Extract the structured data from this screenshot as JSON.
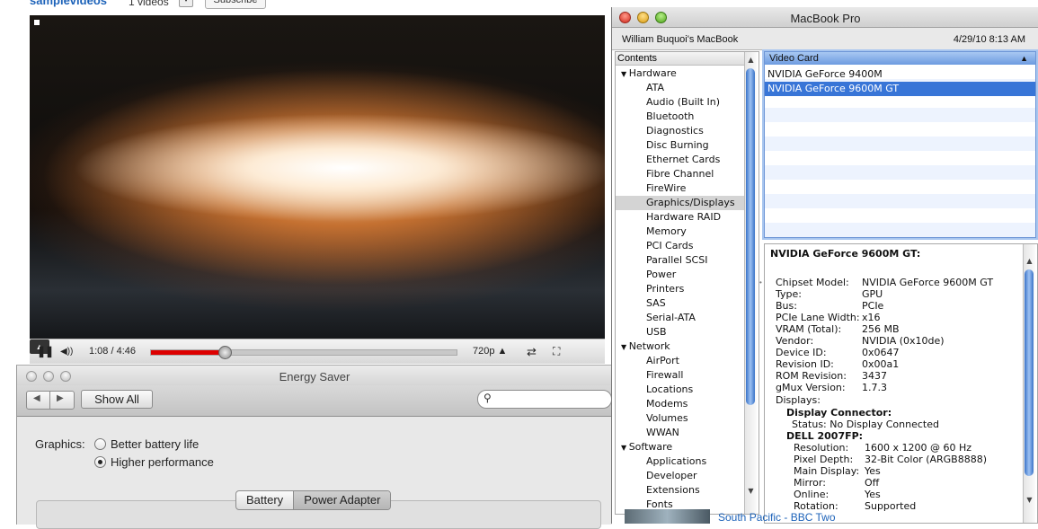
{
  "youtube": {
    "channel": "samplevideos",
    "videos_count": "1 videos",
    "subscribe_label": "Subscribe",
    "time": "1:08 / 4:46",
    "progress": 0.24,
    "quality": "720p",
    "related_link": "South Pacific - BBC Two"
  },
  "energy_saver": {
    "title": "Energy Saver",
    "show_all": "Show All",
    "search_placeholder": "",
    "graphics_label": "Graphics:",
    "options": [
      "Better battery life",
      "Higher performance"
    ],
    "selected_option": "Higher performance",
    "tabs": [
      "Battery",
      "Power Adapter"
    ],
    "selected_tab": "Power Adapter"
  },
  "profiler": {
    "title": "MacBook Pro",
    "machine_name": "William Buquoi's MacBook",
    "date": "4/29/10 8:13 AM",
    "contents_header": "Contents",
    "tree": [
      {
        "label": "Hardware",
        "type": "cat"
      },
      {
        "label": "ATA",
        "type": "item"
      },
      {
        "label": "Audio (Built In)",
        "type": "item"
      },
      {
        "label": "Bluetooth",
        "type": "item"
      },
      {
        "label": "Diagnostics",
        "type": "item"
      },
      {
        "label": "Disc Burning",
        "type": "item"
      },
      {
        "label": "Ethernet Cards",
        "type": "item"
      },
      {
        "label": "Fibre Channel",
        "type": "item"
      },
      {
        "label": "FireWire",
        "type": "item"
      },
      {
        "label": "Graphics/Displays",
        "type": "item",
        "selected": true
      },
      {
        "label": "Hardware RAID",
        "type": "item"
      },
      {
        "label": "Memory",
        "type": "item"
      },
      {
        "label": "PCI Cards",
        "type": "item"
      },
      {
        "label": "Parallel SCSI",
        "type": "item"
      },
      {
        "label": "Power",
        "type": "item"
      },
      {
        "label": "Printers",
        "type": "item"
      },
      {
        "label": "SAS",
        "type": "item"
      },
      {
        "label": "Serial-ATA",
        "type": "item"
      },
      {
        "label": "USB",
        "type": "item"
      },
      {
        "label": "Network",
        "type": "cat"
      },
      {
        "label": "AirPort",
        "type": "item"
      },
      {
        "label": "Firewall",
        "type": "item"
      },
      {
        "label": "Locations",
        "type": "item"
      },
      {
        "label": "Modems",
        "type": "item"
      },
      {
        "label": "Volumes",
        "type": "item"
      },
      {
        "label": "WWAN",
        "type": "item"
      },
      {
        "label": "Software",
        "type": "cat"
      },
      {
        "label": "Applications",
        "type": "item"
      },
      {
        "label": "Developer",
        "type": "item"
      },
      {
        "label": "Extensions",
        "type": "item"
      },
      {
        "label": "Fonts",
        "type": "item"
      }
    ],
    "card_header": "Video Card",
    "cards": [
      "NVIDIA GeForce 9400M",
      "NVIDIA GeForce 9600M GT"
    ],
    "selected_card": "NVIDIA GeForce 9600M GT",
    "detail_title": "NVIDIA GeForce 9600M GT:",
    "details": [
      {
        "k": "Chipset Model:",
        "v": "NVIDIA GeForce 9600M GT"
      },
      {
        "k": "Type:",
        "v": "GPU"
      },
      {
        "k": "Bus:",
        "v": "PCIe"
      },
      {
        "k": "PCIe Lane Width:",
        "v": "x16"
      },
      {
        "k": "VRAM (Total):",
        "v": "256 MB"
      },
      {
        "k": "Vendor:",
        "v": "NVIDIA (0x10de)"
      },
      {
        "k": "Device ID:",
        "v": "0x0647"
      },
      {
        "k": "Revision ID:",
        "v": "0x00a1"
      },
      {
        "k": "ROM Revision:",
        "v": "3437"
      },
      {
        "k": "gMux Version:",
        "v": "1.7.3"
      }
    ],
    "displays_label": "Displays:",
    "display_connector_label": "Display Connector:",
    "display_connector_status": "Status:  No Display Connected",
    "dell_label": "DELL 2007FP:",
    "dell_details": [
      {
        "k": "Resolution:",
        "v": "1600 x 1200 @ 60 Hz"
      },
      {
        "k": "Pixel Depth:",
        "v": "32-Bit Color (ARGB8888)"
      },
      {
        "k": "Main Display:",
        "v": "Yes"
      },
      {
        "k": "Mirror:",
        "v": "Off"
      },
      {
        "k": "Online:",
        "v": "Yes"
      },
      {
        "k": "Rotation:",
        "v": "Supported"
      }
    ]
  }
}
